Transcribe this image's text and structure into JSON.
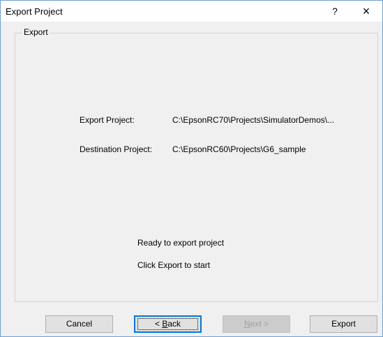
{
  "window": {
    "title": "Export Project",
    "help_glyph": "?",
    "close_glyph": "×"
  },
  "group": {
    "label": "Export"
  },
  "fields": [
    {
      "label": "Export Project:",
      "value": "C:\\EpsonRC70\\Projects\\SimulatorDemos\\..."
    },
    {
      "label": "Destination Project:",
      "value": "C:\\EpsonRC60\\Projects\\G6_sample"
    }
  ],
  "status": {
    "line1": "Ready to export project",
    "line2": "Click Export to start"
  },
  "buttons": {
    "cancel": "Cancel",
    "back_prefix": "< ",
    "back_mnemonic": "B",
    "back_rest": "ack",
    "next_mnemonic": "N",
    "next_rest": "ext >",
    "export": "Export"
  },
  "colors": {
    "focus_border": "#0078d7",
    "window_border": "#6f9ed3",
    "disabled_text": "#a0a0a0"
  }
}
